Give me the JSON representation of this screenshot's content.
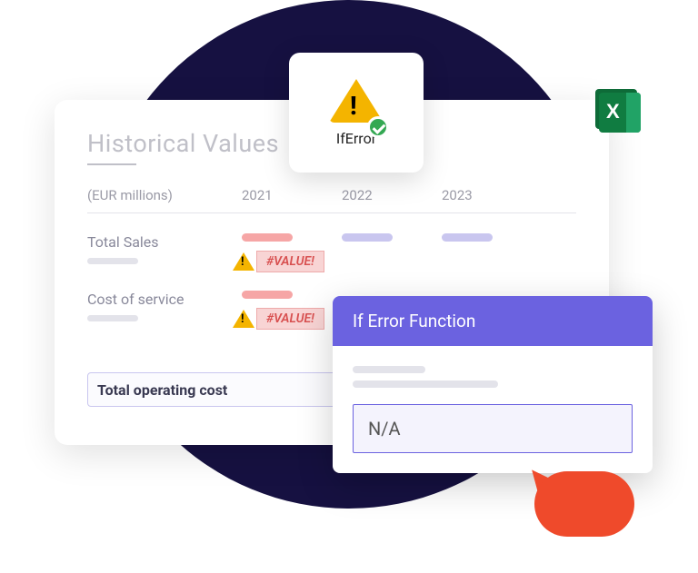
{
  "card": {
    "title": "Historical Values",
    "units": "(EUR millions)",
    "years": [
      "2021",
      "2022",
      "2023"
    ],
    "rows": {
      "sales": {
        "label": "Total Sales",
        "error": "#VALUE!"
      },
      "cost": {
        "label": "Cost of service",
        "error": "#VALUE!"
      }
    },
    "total_label": "Total operating cost"
  },
  "iferror_badge": {
    "label": "IfError"
  },
  "fn_popup": {
    "title": "If Error Function",
    "value": "N/A"
  }
}
